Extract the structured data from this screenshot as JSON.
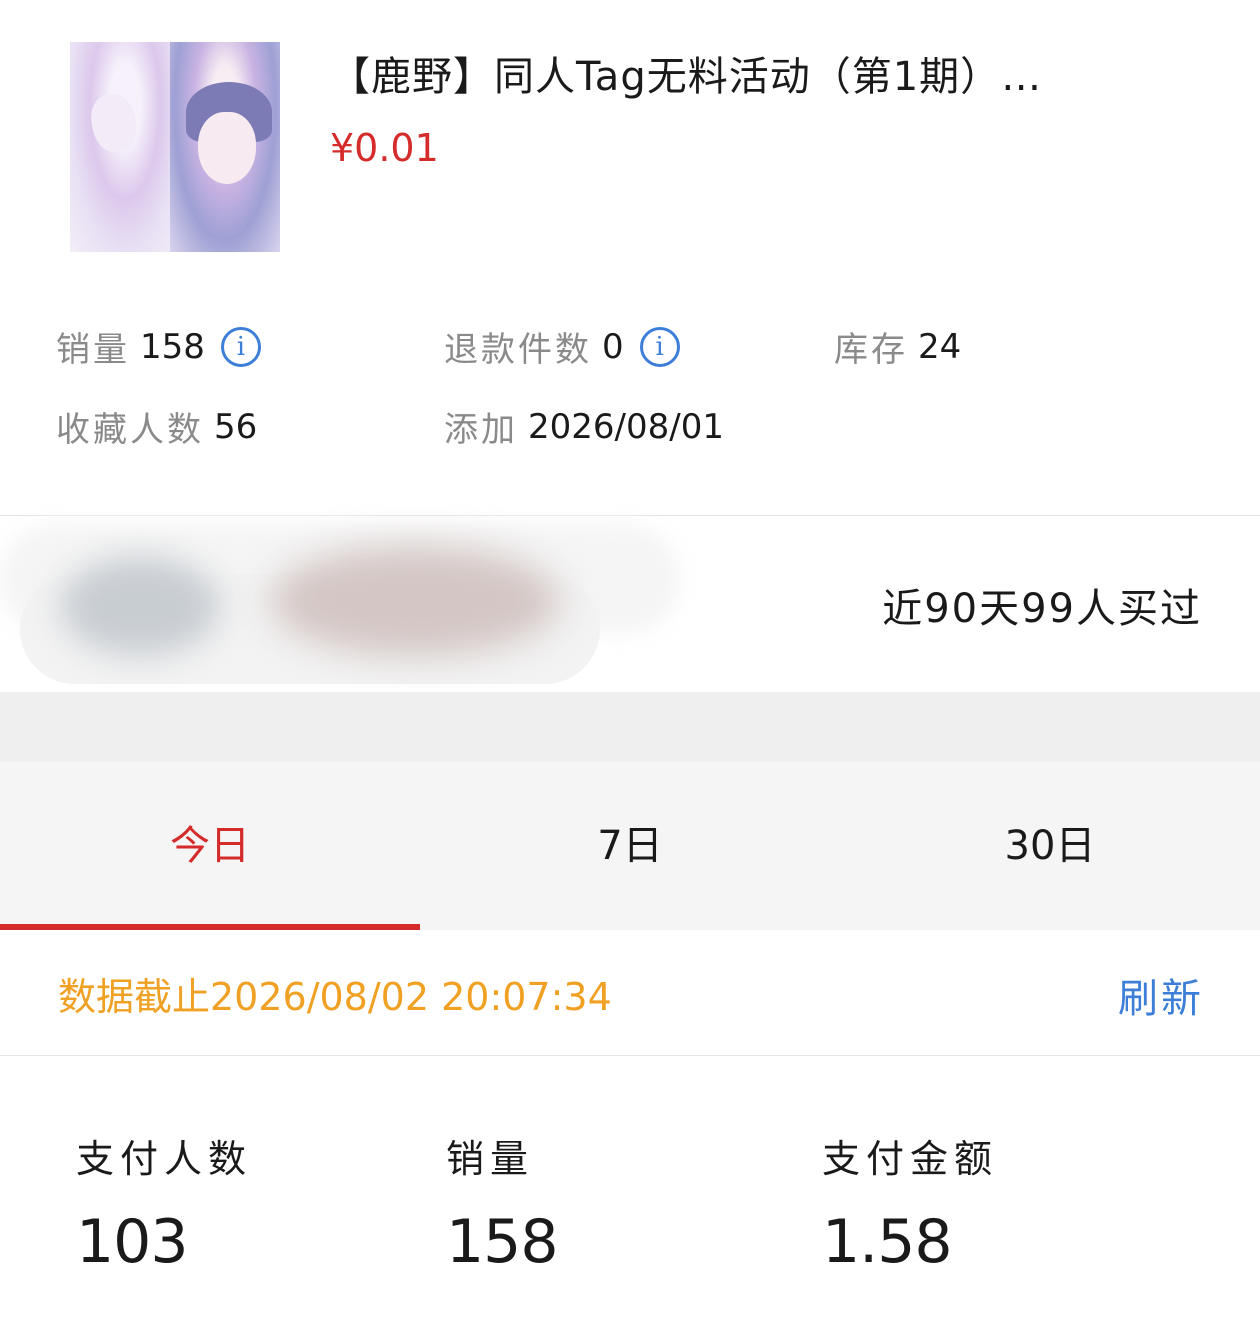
{
  "product": {
    "title": "【鹿野】同人Tag无料活动（第1期）…",
    "price": "¥0.01",
    "image": "product-cover-illustration"
  },
  "stats": {
    "sales_label": "销量",
    "sales_value": "158",
    "refund_label": "退款件数",
    "refund_value": "0",
    "stock_label": "库存",
    "stock_value": "24",
    "favorites_label": "收藏人数",
    "favorites_value": "56",
    "added_label": "添加",
    "added_value": "2026/08/01"
  },
  "buyers": {
    "summary": "近90天99人买过"
  },
  "tabs": [
    {
      "label": "今日",
      "active": true
    },
    {
      "label": "7日",
      "active": false
    },
    {
      "label": "30日",
      "active": false
    }
  ],
  "data_status": {
    "as_of": "数据截止2026/08/02 20:07:34",
    "refresh_label": "刷新"
  },
  "metrics": [
    {
      "label": "支付人数",
      "value": "103"
    },
    {
      "label": "销量",
      "value": "158"
    },
    {
      "label": "支付金额",
      "value": "1.58"
    }
  ],
  "colors": {
    "accent_red": "#d52b2b",
    "info_blue": "#3d7fd8",
    "status_orange": "#f0a124"
  }
}
